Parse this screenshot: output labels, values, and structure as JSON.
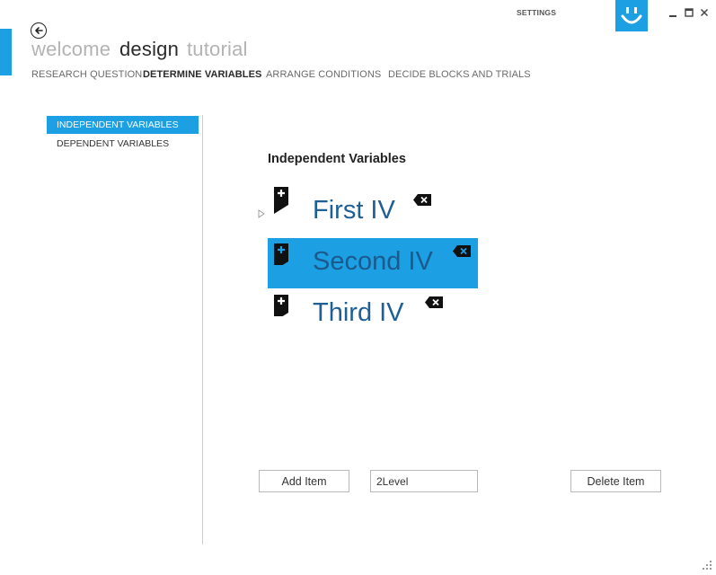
{
  "window": {
    "settings_label": "SETTINGS",
    "icons": [
      "back-arrow-icon",
      "smiley-icon",
      "minimize-icon",
      "maximize-icon",
      "close-icon",
      "resize-grip-icon"
    ],
    "accent_color": "#1d9fe3"
  },
  "nav": {
    "items": [
      {
        "label": "welcome",
        "active": false
      },
      {
        "label": "design",
        "active": true
      },
      {
        "label": "tutorial",
        "active": false
      }
    ],
    "sub_items": [
      {
        "label": "RESEARCH QUESTION",
        "active": false
      },
      {
        "label": "DETERMINE VARIABLES",
        "active": true
      },
      {
        "label": "ARRANGE CONDITIONS",
        "active": false
      },
      {
        "label": "DECIDE BLOCKS AND TRIALS",
        "active": false
      }
    ]
  },
  "sidebar": {
    "items": [
      {
        "label": "INDEPENDENT VARIABLES",
        "selected": true
      },
      {
        "label": "DEPENDENT VARIABLES",
        "selected": false
      }
    ]
  },
  "main": {
    "title": "Independent Variables",
    "variables": [
      {
        "label": "First IV",
        "selected": false
      },
      {
        "label": "Second IV",
        "selected": true
      },
      {
        "label": "Third IV",
        "selected": false
      }
    ]
  },
  "controls": {
    "add_label": "Add Item",
    "level_value": "2Level",
    "delete_label": "Delete Item"
  }
}
